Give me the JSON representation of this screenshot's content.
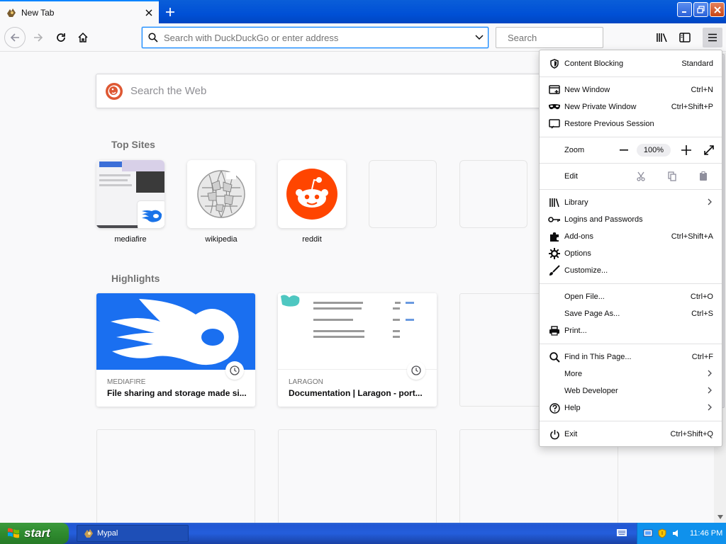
{
  "tab": {
    "title": "New Tab"
  },
  "toolbar": {
    "url_placeholder": "Search with DuckDuckGo or enter address",
    "search_placeholder": "Search"
  },
  "newtab": {
    "websearch_placeholder": "Search the Web",
    "top_sites_title": "Top Sites",
    "top_sites": [
      {
        "label": "mediafire"
      },
      {
        "label": "wikipedia"
      },
      {
        "label": "reddit"
      }
    ],
    "highlights_title": "Highlights",
    "highlights": [
      {
        "context": "MEDIAFIRE",
        "title": "File sharing and storage made si..."
      },
      {
        "context": "LARAGON",
        "title": "Documentation | Laragon - port..."
      }
    ]
  },
  "app_menu": {
    "content_blocking": {
      "label": "Content Blocking",
      "value": "Standard"
    },
    "new_window": {
      "label": "New Window",
      "key": "Ctrl+N"
    },
    "new_private_window": {
      "label": "New Private Window",
      "key": "Ctrl+Shift+P"
    },
    "restore_session": {
      "label": "Restore Previous Session"
    },
    "zoom": {
      "label": "Zoom",
      "value": "100%"
    },
    "edit": {
      "label": "Edit"
    },
    "library": {
      "label": "Library"
    },
    "logins": {
      "label": "Logins and Passwords"
    },
    "addons": {
      "label": "Add-ons",
      "key": "Ctrl+Shift+A"
    },
    "options": {
      "label": "Options"
    },
    "customize": {
      "label": "Customize..."
    },
    "open_file": {
      "label": "Open File...",
      "key": "Ctrl+O"
    },
    "save_page": {
      "label": "Save Page As...",
      "key": "Ctrl+S"
    },
    "print": {
      "label": "Print..."
    },
    "find": {
      "label": "Find in This Page...",
      "key": "Ctrl+F"
    },
    "more": {
      "label": "More"
    },
    "web_developer": {
      "label": "Web Developer"
    },
    "help": {
      "label": "Help"
    },
    "exit": {
      "label": "Exit",
      "key": "Ctrl+Shift+Q"
    }
  },
  "taskbar": {
    "start_label": "start",
    "task_label": "Mypal",
    "clock": "11:46 PM"
  },
  "colors": {
    "accent": "#0a84ff",
    "reddit": "#ff4500",
    "mediafire": "#1a73e8",
    "xp_taskbar": "#245edb",
    "xp_start": "#2f8b2f"
  }
}
